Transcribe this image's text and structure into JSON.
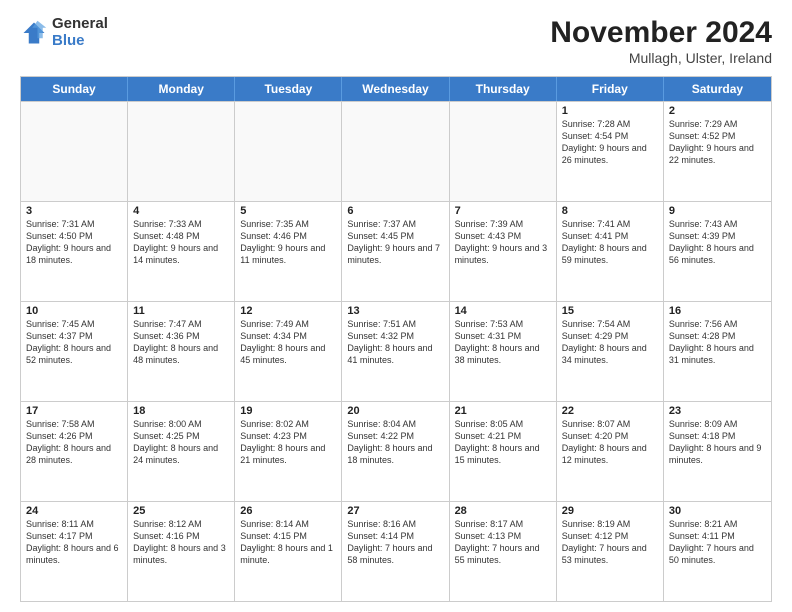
{
  "logo": {
    "general": "General",
    "blue": "Blue"
  },
  "header": {
    "month": "November 2024",
    "location": "Mullagh, Ulster, Ireland"
  },
  "weekdays": [
    "Sunday",
    "Monday",
    "Tuesday",
    "Wednesday",
    "Thursday",
    "Friday",
    "Saturday"
  ],
  "rows": [
    [
      {
        "day": "",
        "text": ""
      },
      {
        "day": "",
        "text": ""
      },
      {
        "day": "",
        "text": ""
      },
      {
        "day": "",
        "text": ""
      },
      {
        "day": "",
        "text": ""
      },
      {
        "day": "1",
        "text": "Sunrise: 7:28 AM\nSunset: 4:54 PM\nDaylight: 9 hours and 26 minutes."
      },
      {
        "day": "2",
        "text": "Sunrise: 7:29 AM\nSunset: 4:52 PM\nDaylight: 9 hours and 22 minutes."
      }
    ],
    [
      {
        "day": "3",
        "text": "Sunrise: 7:31 AM\nSunset: 4:50 PM\nDaylight: 9 hours and 18 minutes."
      },
      {
        "day": "4",
        "text": "Sunrise: 7:33 AM\nSunset: 4:48 PM\nDaylight: 9 hours and 14 minutes."
      },
      {
        "day": "5",
        "text": "Sunrise: 7:35 AM\nSunset: 4:46 PM\nDaylight: 9 hours and 11 minutes."
      },
      {
        "day": "6",
        "text": "Sunrise: 7:37 AM\nSunset: 4:45 PM\nDaylight: 9 hours and 7 minutes."
      },
      {
        "day": "7",
        "text": "Sunrise: 7:39 AM\nSunset: 4:43 PM\nDaylight: 9 hours and 3 minutes."
      },
      {
        "day": "8",
        "text": "Sunrise: 7:41 AM\nSunset: 4:41 PM\nDaylight: 8 hours and 59 minutes."
      },
      {
        "day": "9",
        "text": "Sunrise: 7:43 AM\nSunset: 4:39 PM\nDaylight: 8 hours and 56 minutes."
      }
    ],
    [
      {
        "day": "10",
        "text": "Sunrise: 7:45 AM\nSunset: 4:37 PM\nDaylight: 8 hours and 52 minutes."
      },
      {
        "day": "11",
        "text": "Sunrise: 7:47 AM\nSunset: 4:36 PM\nDaylight: 8 hours and 48 minutes."
      },
      {
        "day": "12",
        "text": "Sunrise: 7:49 AM\nSunset: 4:34 PM\nDaylight: 8 hours and 45 minutes."
      },
      {
        "day": "13",
        "text": "Sunrise: 7:51 AM\nSunset: 4:32 PM\nDaylight: 8 hours and 41 minutes."
      },
      {
        "day": "14",
        "text": "Sunrise: 7:53 AM\nSunset: 4:31 PM\nDaylight: 8 hours and 38 minutes."
      },
      {
        "day": "15",
        "text": "Sunrise: 7:54 AM\nSunset: 4:29 PM\nDaylight: 8 hours and 34 minutes."
      },
      {
        "day": "16",
        "text": "Sunrise: 7:56 AM\nSunset: 4:28 PM\nDaylight: 8 hours and 31 minutes."
      }
    ],
    [
      {
        "day": "17",
        "text": "Sunrise: 7:58 AM\nSunset: 4:26 PM\nDaylight: 8 hours and 28 minutes."
      },
      {
        "day": "18",
        "text": "Sunrise: 8:00 AM\nSunset: 4:25 PM\nDaylight: 8 hours and 24 minutes."
      },
      {
        "day": "19",
        "text": "Sunrise: 8:02 AM\nSunset: 4:23 PM\nDaylight: 8 hours and 21 minutes."
      },
      {
        "day": "20",
        "text": "Sunrise: 8:04 AM\nSunset: 4:22 PM\nDaylight: 8 hours and 18 minutes."
      },
      {
        "day": "21",
        "text": "Sunrise: 8:05 AM\nSunset: 4:21 PM\nDaylight: 8 hours and 15 minutes."
      },
      {
        "day": "22",
        "text": "Sunrise: 8:07 AM\nSunset: 4:20 PM\nDaylight: 8 hours and 12 minutes."
      },
      {
        "day": "23",
        "text": "Sunrise: 8:09 AM\nSunset: 4:18 PM\nDaylight: 8 hours and 9 minutes."
      }
    ],
    [
      {
        "day": "24",
        "text": "Sunrise: 8:11 AM\nSunset: 4:17 PM\nDaylight: 8 hours and 6 minutes."
      },
      {
        "day": "25",
        "text": "Sunrise: 8:12 AM\nSunset: 4:16 PM\nDaylight: 8 hours and 3 minutes."
      },
      {
        "day": "26",
        "text": "Sunrise: 8:14 AM\nSunset: 4:15 PM\nDaylight: 8 hours and 1 minute."
      },
      {
        "day": "27",
        "text": "Sunrise: 8:16 AM\nSunset: 4:14 PM\nDaylight: 7 hours and 58 minutes."
      },
      {
        "day": "28",
        "text": "Sunrise: 8:17 AM\nSunset: 4:13 PM\nDaylight: 7 hours and 55 minutes."
      },
      {
        "day": "29",
        "text": "Sunrise: 8:19 AM\nSunset: 4:12 PM\nDaylight: 7 hours and 53 minutes."
      },
      {
        "day": "30",
        "text": "Sunrise: 8:21 AM\nSunset: 4:11 PM\nDaylight: 7 hours and 50 minutes."
      }
    ]
  ]
}
